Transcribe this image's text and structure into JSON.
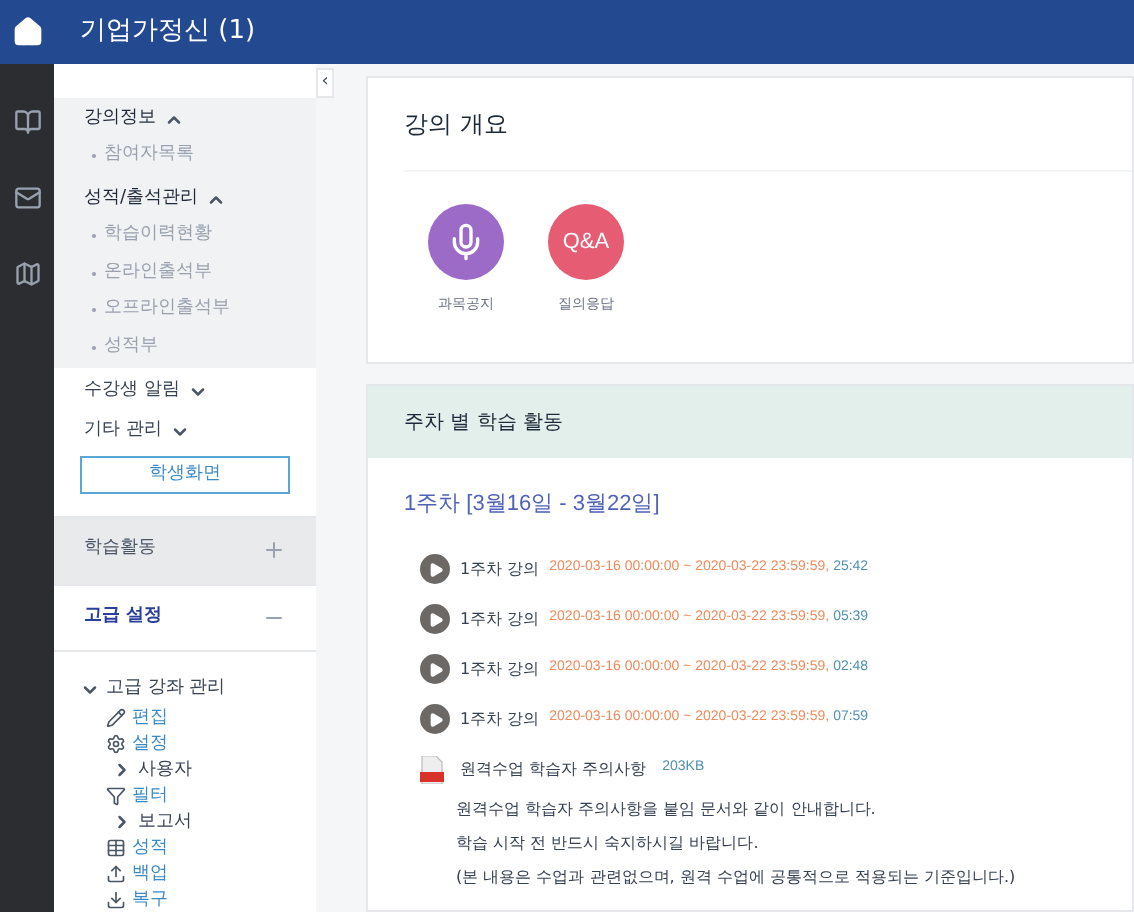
{
  "header": {
    "title": "기업가정신 (1)"
  },
  "sidebar": {
    "sections": [
      {
        "title": "강의정보",
        "expanded": true,
        "items": [
          "참여자목록"
        ]
      },
      {
        "title": "성적/출석관리",
        "expanded": true,
        "items": [
          "학습이력현황",
          "온라인출석부",
          "오프라인출석부",
          "성적부"
        ]
      }
    ],
    "menus": [
      {
        "label": "수강생 알림",
        "expanded": false
      },
      {
        "label": "기타 관리",
        "expanded": false
      }
    ],
    "student_view_button": "학생화면",
    "blocks": [
      {
        "title": "학습활동",
        "expanded": false
      },
      {
        "title": "고급 설정",
        "expanded": true
      }
    ],
    "tree": {
      "label": "고급 강좌 관리",
      "expanded": true,
      "children": [
        {
          "kind": "link",
          "label": "편집"
        },
        {
          "kind": "link",
          "label": "설정"
        },
        {
          "kind": "branch",
          "label": "사용자",
          "expanded": false
        },
        {
          "kind": "link",
          "label": "필터"
        },
        {
          "kind": "branch",
          "label": "보고서",
          "expanded": false
        },
        {
          "kind": "link",
          "label": "성적"
        },
        {
          "kind": "link",
          "label": "백업"
        },
        {
          "kind": "link",
          "label": "복구"
        }
      ]
    }
  },
  "collapse_tab": "‹",
  "overview": {
    "title": "강의 개요",
    "shortcuts": [
      {
        "kind": "mic",
        "label": "과목공지",
        "color": "#9c6bc7"
      },
      {
        "kind": "qa",
        "badge": "Q&A",
        "label": "질의응답",
        "color": "#e65c72"
      }
    ]
  },
  "weekly": {
    "title": "주차 별 학습 활동",
    "week_title": "1주차 [3월16일 - 3월22일]",
    "lectures": [
      {
        "name": "1주차 강의",
        "period": "2020-03-16 00:00:00 ~ 2020-03-22 23:59:59,",
        "duration": "25:42"
      },
      {
        "name": "1주차 강의",
        "period": "2020-03-16 00:00:00 ~ 2020-03-22 23:59:59,",
        "duration": "05:39"
      },
      {
        "name": "1주차 강의",
        "period": "2020-03-16 00:00:00 ~ 2020-03-22 23:59:59,",
        "duration": "02:48"
      },
      {
        "name": "1주차 강의",
        "period": "2020-03-16 00:00:00 ~ 2020-03-22 23:59:59,",
        "duration": "07:59"
      }
    ],
    "file": {
      "name": "원격수업 학습자 주의사항",
      "size": "203KB"
    },
    "notes": [
      "원격수업 학습자 주의사항을 붙임 문서와 같이 안내합니다.",
      "학습 시작 전 반드시 숙지하시길 바랍니다.",
      "(본 내용은 수업과 관련없으며, 원격 수업에 공통적으로 적용되는 기준입니다.)"
    ]
  }
}
